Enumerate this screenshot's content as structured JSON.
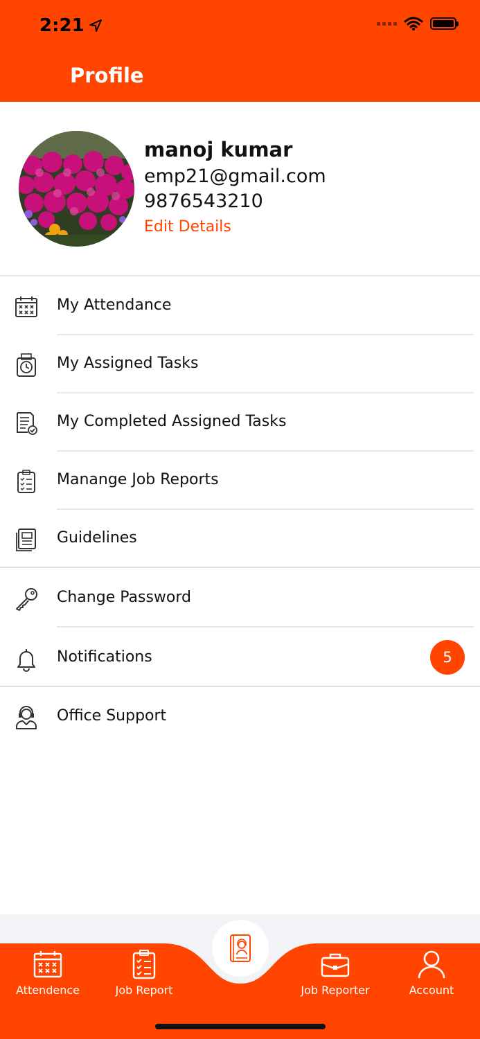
{
  "status_bar": {
    "time": "2:21"
  },
  "header": {
    "title": "Profile"
  },
  "profile": {
    "name": "manoj kumar",
    "email": "emp21@gmail.com",
    "phone": "9876543210",
    "edit_label": "Edit Details"
  },
  "menu": [
    {
      "label": "My Attendance",
      "icon": "calendar-icon"
    },
    {
      "label": "My Assigned Tasks",
      "icon": "task-clock-icon"
    },
    {
      "label": "My Completed Assigned Tasks",
      "icon": "completed-doc-icon"
    },
    {
      "label": "Manange Job Reports",
      "icon": "clipboard-icon"
    },
    {
      "label": "Guidelines",
      "icon": "guidelines-icon"
    },
    {
      "label": "Change Password",
      "icon": "key-icon"
    },
    {
      "label": "Notifications",
      "icon": "bell-icon",
      "badge": "5"
    },
    {
      "label": "Office Support",
      "icon": "support-agent-icon"
    }
  ],
  "tabs": [
    {
      "label": "Attendence",
      "icon": "calendar-icon"
    },
    {
      "label": "Job Report",
      "icon": "clipboard-icon"
    },
    {
      "label": "Job Reporter",
      "icon": "briefcase-icon"
    },
    {
      "label": "Account",
      "icon": "person-icon"
    }
  ],
  "center_button": {
    "icon": "support-book-icon"
  },
  "colors": {
    "accent": "#FF4500",
    "divider": "#E6E6E6"
  }
}
